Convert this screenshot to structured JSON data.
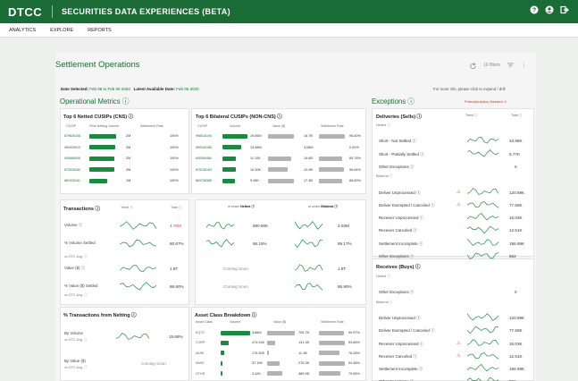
{
  "header": {
    "logo": "DTCC",
    "title": "SECURITIES DATA EXPERIENCES (BETA)",
    "icons": [
      "help-icon",
      "user-icon",
      "logout-icon"
    ]
  },
  "nav": {
    "items": [
      "ANALYTICS",
      "EXPLORE",
      "REPORTS"
    ]
  },
  "page": {
    "title": "Settlement Operations",
    "filters": "10 filters",
    "date_label": "Date Selected:",
    "date_value": "Feb 06 to Feb 06 2020",
    "latest_label": "Latest Available Date:",
    "latest_value": "Feb 06 2020",
    "more_info": "For more info, please click to expand / drill"
  },
  "operational": {
    "heading": "Operational Metrics ⓘ"
  },
  "netted": {
    "title": "Top 6 Netted CUSIPs (CNS) ⓘ",
    "headers": [
      "CUSIP",
      "Final Netting Volume",
      "Settlement Rate"
    ],
    "rows": [
      {
        "cusip": "879830108",
        "vol": "2M",
        "rate": "100%"
      },
      {
        "cusip": "983939910",
        "vol": "2M",
        "rate": "100%"
      },
      {
        "cusip": "945666006",
        "vol": "2M",
        "rate": "100%"
      },
      {
        "cusip": "873035160",
        "vol": "2M",
        "rate": "100%"
      },
      {
        "cusip": "881939161",
        "vol": "1M",
        "rate": "100%"
      }
    ],
    "vol_fill": [
      0.95,
      0.9,
      0.88,
      0.86,
      0.62
    ]
  },
  "bilateral": {
    "title": "Top 6 Bilateral CUSIPs (NON-CNS) ⓘ",
    "headers": [
      "CUSIP",
      "Volume",
      "Value ($)",
      "Settlement Rate"
    ],
    "rows": [
      {
        "cusip": "998016194",
        "vol": "19.56M",
        "value": "16.7B",
        "rate": "96.60%"
      },
      {
        "cusip": "590040185",
        "vol": "13.98M",
        "value": "3.08M",
        "rate": "0.00%"
      },
      {
        "cusip": "690060480",
        "vol": "11.10K",
        "value": "14.6B",
        "rate": "89.78%"
      },
      {
        "cusip": "875135183",
        "vol": "10.30K",
        "value": "12.0B",
        "rate": "96.64%"
      },
      {
        "cusip": "883708385",
        "vol": "9.45K",
        "value": "17.3B",
        "rate": "88.59%"
      }
    ],
    "vol_fill": [
      1.0,
      0.76,
      0.55,
      0.52,
      0.5
    ],
    "value_fill": [
      0.9,
      0.0,
      0.8,
      0.68,
      0.92
    ],
    "rate_fill": [
      0.95,
      0.0,
      0.87,
      0.93,
      0.85
    ]
  },
  "transactions": {
    "title": "Transactions ⓘ",
    "trend": "Trend ⓘ",
    "total": "Total ⓘ",
    "of_which": "of which",
    "netted": "Netted ⓘ",
    "bilateral": "Bilateral ⓘ",
    "rows": [
      {
        "label": "Volume ⓘ",
        "sub": "",
        "total": "4.76M",
        "netted": "690.60K",
        "bilateral": "3.03M"
      },
      {
        "label": "% Volume Settled",
        "sub": "vs DTC Avg. ⓘ",
        "total": "80.67%",
        "netted": "96.15%",
        "bilateral": "89.17%"
      },
      {
        "label": "Value ($) ⓘ",
        "sub": "",
        "total": "1.8T",
        "netted": "Coming Soon",
        "bilateral": "1.8T"
      },
      {
        "label": "% Value ($) Settled",
        "sub": "vs DTC Avg. ⓘ",
        "total": "86.90%",
        "netted": "Coming Soon",
        "bilateral": "86.90%"
      }
    ]
  },
  "netting": {
    "title": "% Transactions from Netting ⓘ",
    "rows": [
      {
        "label": "By Volume",
        "sub": "vs DTC Avg. ⓘ",
        "value": "15.68%"
      },
      {
        "label": "By Value ($)",
        "sub": "vs DTC Avg. ⓘ",
        "value": "Coming Soon"
      }
    ]
  },
  "asset": {
    "title": "Asset Class Breakdown ⓘ",
    "headers": [
      "Asset Class",
      "Volume",
      "Value ($)",
      "Settlement Rate"
    ],
    "rows": [
      {
        "cls": "EQTS",
        "vol": "3.86M",
        "value": "705.7B",
        "rate": "90.97%"
      },
      {
        "cls": "CORP",
        "vol": "474.94K",
        "value": "131.1B",
        "rate": "93.66%"
      },
      {
        "cls": "MUNI",
        "vol": "176.30K",
        "value": "11.1B",
        "rate": "76.28%"
      },
      {
        "cls": "MMIS",
        "vol": "37.15K",
        "value": "276.2B",
        "rate": "94.38%"
      },
      {
        "cls": "OTHR",
        "vol": "3.42K",
        "value": "385.9B",
        "rate": "79.55%"
      }
    ],
    "vol_fill": [
      1.0,
      0.25,
      0.1,
      0.04,
      0.02
    ],
    "value_fill": [
      1.0,
      0.28,
      0.06,
      0.45,
      0.55
    ],
    "rate_fill": [
      0.92,
      0.95,
      0.77,
      0.96,
      0.8
    ]
  },
  "exceptions": {
    "heading": "Exceptions ⓘ",
    "potential": "Potential Action Needed",
    "deliveries_title": "Deliveries (Sells) ⓘ",
    "trend": "Trend ⓘ",
    "total": "Total ⓘ",
    "deliveries": [
      {
        "type": "section",
        "label": "Netted ⓘ"
      },
      {
        "type": "row",
        "label": "Short - Not Settled ⓘ",
        "value": "10.96K",
        "warn": false,
        "spark": true
      },
      {
        "type": "row",
        "label": "Short - Partially Settled ⓘ",
        "value": "5.77K",
        "warn": false,
        "spark": true
      },
      {
        "type": "row",
        "label": "Other Exceptions ⓘ",
        "value": "0",
        "warn": false,
        "spark": false
      },
      {
        "type": "section",
        "label": "Bilateral ⓘ"
      },
      {
        "type": "row",
        "label": "Deliver Unprocessed ⓘ",
        "value": "120.69K",
        "warn": true,
        "spark": true
      },
      {
        "type": "row",
        "label": "Deliver Exempted / Canceled ⓘ",
        "value": "77.59K",
        "warn": true,
        "spark": true
      },
      {
        "type": "row",
        "label": "Receiver Unprocessed ⓘ",
        "value": "16.03K",
        "warn": false,
        "spark": true
      },
      {
        "type": "row",
        "label": "Receiver Canceled ⓘ",
        "value": "12.51K",
        "warn": false,
        "spark": true
      },
      {
        "type": "row",
        "label": "Settlement Incomplete ⓘ",
        "value": "186.69K",
        "warn": false,
        "spark": true
      },
      {
        "type": "row",
        "label": "Other Exceptions ⓘ",
        "value": "552",
        "warn": false,
        "spark": true
      }
    ],
    "receives_title": "Receives (Buys) ⓘ",
    "receives": [
      {
        "type": "section",
        "label": "Netted ⓘ"
      },
      {
        "type": "row",
        "label": "Other Exceptions ⓘ",
        "value": "0",
        "warn": false,
        "spark": false
      },
      {
        "type": "section",
        "label": "Bilateral ⓘ"
      },
      {
        "type": "row",
        "label": "Deliver Unprocessed ⓘ",
        "value": "120.69K",
        "warn": false,
        "spark": true
      },
      {
        "type": "row",
        "label": "Deliver Exempted / Canceled ⓘ",
        "value": "77.59K",
        "warn": false,
        "spark": true
      },
      {
        "type": "row",
        "label": "Receiver Unprocessed ⓘ",
        "value": "16.03K",
        "warn": true,
        "spark": true
      },
      {
        "type": "row",
        "label": "Receiver Canceled ⓘ",
        "value": "12.51K",
        "warn": true,
        "spark": true
      },
      {
        "type": "row",
        "label": "Settlement Incomplete ⓘ",
        "value": "186.69K",
        "warn": false,
        "spark": true
      },
      {
        "type": "row",
        "label": "Other Exceptions ⓘ",
        "value": "552",
        "warn": false,
        "spark": true
      }
    ]
  }
}
